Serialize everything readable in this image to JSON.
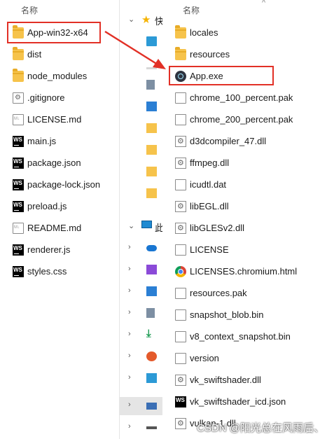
{
  "left_pane": {
    "column_header": "名称",
    "items": [
      {
        "name": "App-win32-x64",
        "icon": "folder-icon"
      },
      {
        "name": "dist",
        "icon": "folder-icon"
      },
      {
        "name": "node_modules",
        "icon": "folder-icon"
      },
      {
        "name": ".gitignore",
        "icon": "settings-file-icon"
      },
      {
        "name": "LICENSE.md",
        "icon": "markdown-file-icon"
      },
      {
        "name": "main.js",
        "icon": "webstorm-icon"
      },
      {
        "name": "package.json",
        "icon": "webstorm-icon"
      },
      {
        "name": "package-lock.json",
        "icon": "webstorm-icon"
      },
      {
        "name": "preload.js",
        "icon": "webstorm-icon"
      },
      {
        "name": "README.md",
        "icon": "markdown-file-icon"
      },
      {
        "name": "renderer.js",
        "icon": "webstorm-icon"
      },
      {
        "name": "styles.css",
        "icon": "webstorm-icon"
      }
    ]
  },
  "nav_pane": {
    "quick_access_label": "快",
    "this_pc_label": "此"
  },
  "right_pane": {
    "column_header": "名称",
    "items": [
      {
        "name": "locales",
        "icon": "folder-icon"
      },
      {
        "name": "resources",
        "icon": "folder-icon"
      },
      {
        "name": "App.exe",
        "icon": "app-icon"
      },
      {
        "name": "chrome_100_percent.pak",
        "icon": "file-icon"
      },
      {
        "name": "chrome_200_percent.pak",
        "icon": "file-icon"
      },
      {
        "name": "d3dcompiler_47.dll",
        "icon": "dll-icon"
      },
      {
        "name": "ffmpeg.dll",
        "icon": "dll-icon"
      },
      {
        "name": "icudtl.dat",
        "icon": "file-icon"
      },
      {
        "name": "libEGL.dll",
        "icon": "dll-icon"
      },
      {
        "name": "libGLESv2.dll",
        "icon": "dll-icon"
      },
      {
        "name": "LICENSE",
        "icon": "file-icon"
      },
      {
        "name": "LICENSES.chromium.html",
        "icon": "chrome-icon"
      },
      {
        "name": "resources.pak",
        "icon": "file-icon"
      },
      {
        "name": "snapshot_blob.bin",
        "icon": "file-icon"
      },
      {
        "name": "v8_context_snapshot.bin",
        "icon": "file-icon"
      },
      {
        "name": "version",
        "icon": "file-icon"
      },
      {
        "name": "vk_swiftshader.dll",
        "icon": "dll-icon"
      },
      {
        "name": "vk_swiftshader_icd.json",
        "icon": "webstorm-icon"
      },
      {
        "name": "vulkan-1.dll",
        "icon": "dll-icon"
      }
    ]
  },
  "watermark": "CSDN @阳光总在风雨后、",
  "colors": {
    "highlight": "#e23026",
    "folder": "#f6c34b",
    "selected_nav": "#e5e5e5"
  }
}
